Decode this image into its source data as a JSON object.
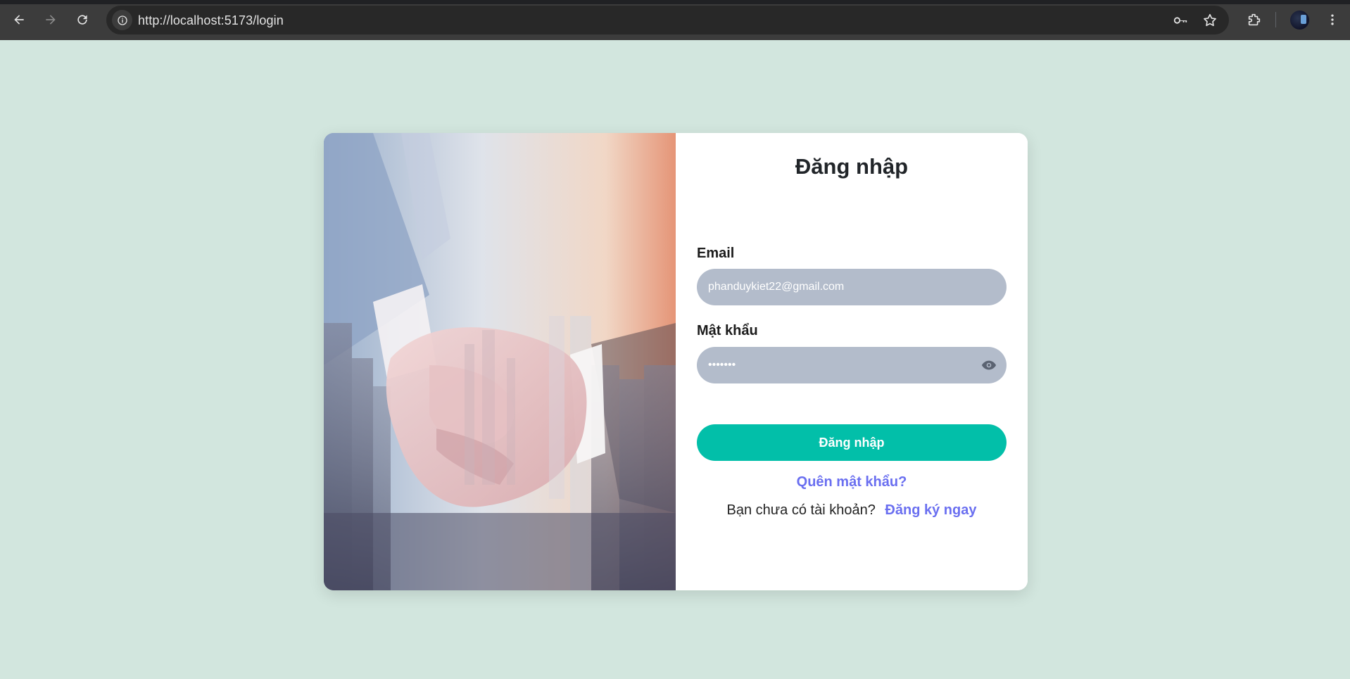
{
  "browser": {
    "url": "http://localhost:5173/login",
    "icons": [
      "back-arrow-icon",
      "forward-arrow-icon",
      "reload-icon",
      "info-icon",
      "key-icon",
      "star-icon",
      "extensions-icon",
      "avatar",
      "kebab-menu-icon"
    ]
  },
  "login": {
    "title": "Đăng nhập",
    "email_label": "Email",
    "email_value": "phanduykiet22@gmail.com",
    "password_label": "Mật khẩu",
    "password_value": "•••••••",
    "submit_label": "Đăng nhập",
    "forgot_label": "Quên mật khẩu?",
    "no_account_text": "Bạn chưa có tài khoản?",
    "signup_label": "Đăng ký ngay"
  },
  "colors": {
    "page_bg": "#d2e6de",
    "input_bg": "#b3bccb",
    "primary": "#02bfa9",
    "link": "#6a6ff0"
  }
}
